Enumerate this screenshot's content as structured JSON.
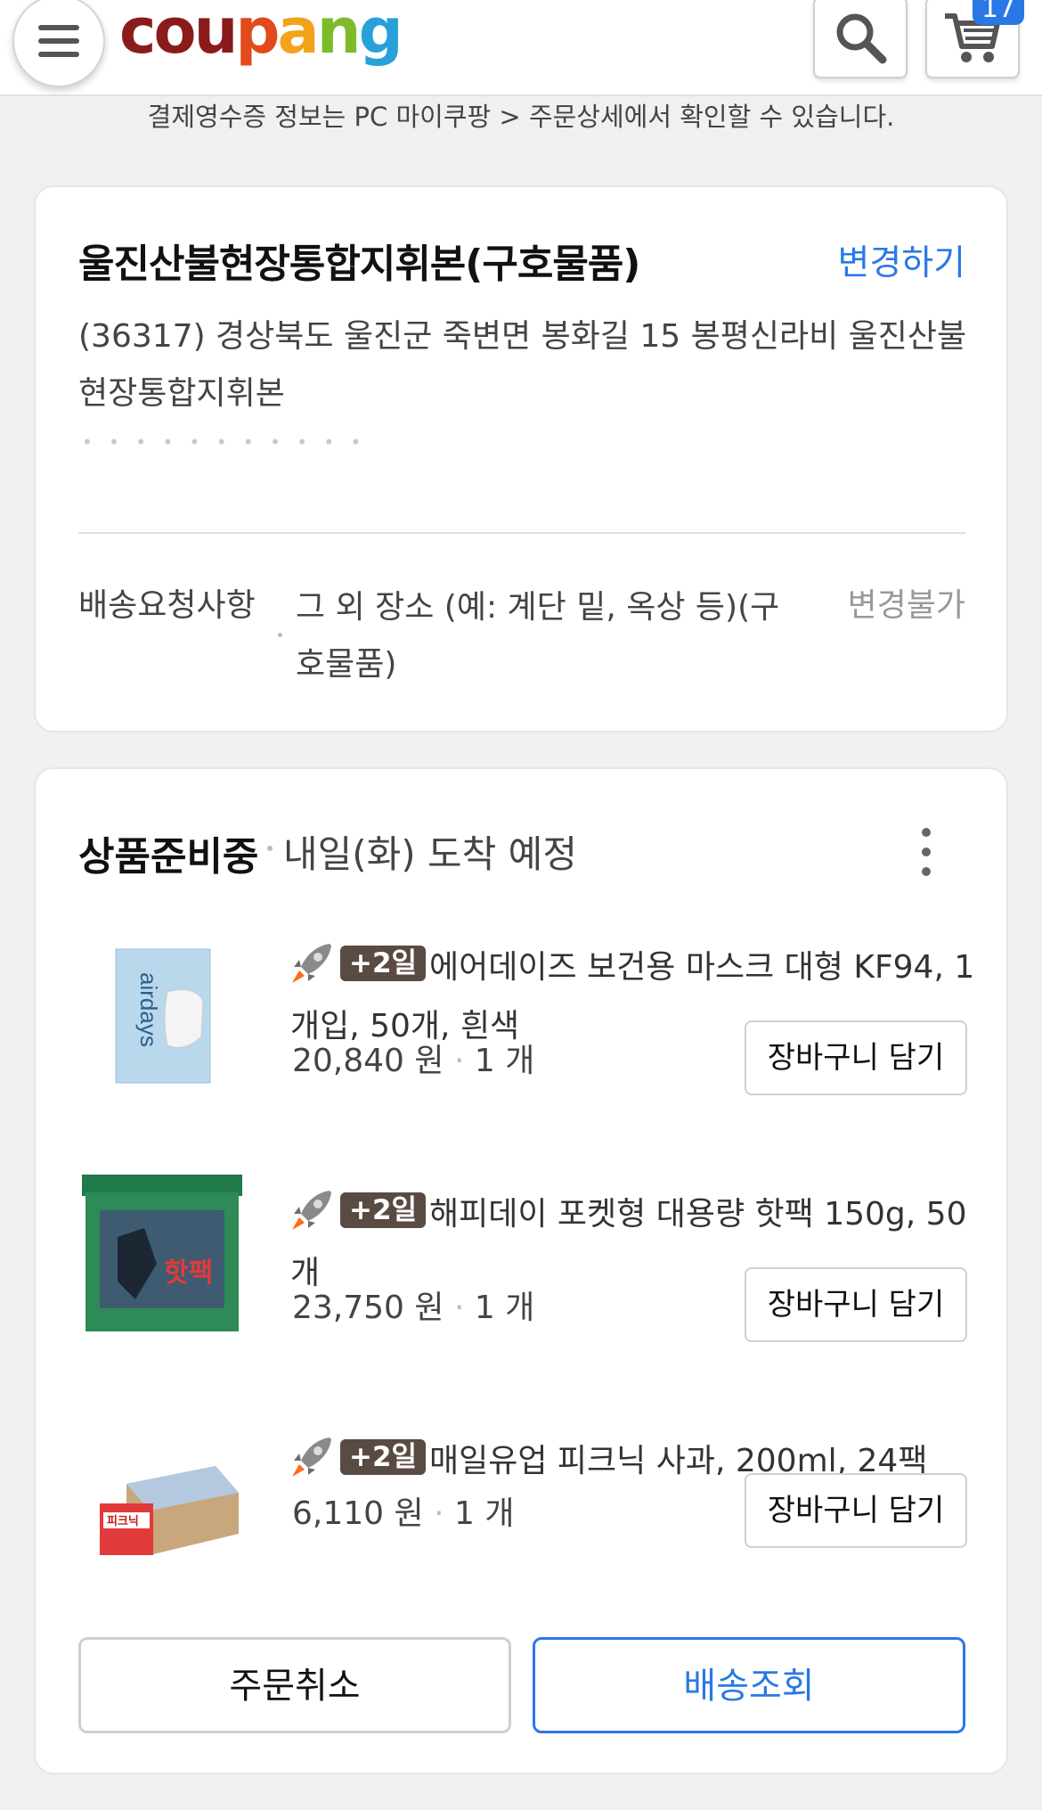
{
  "header": {
    "logo": [
      "cou",
      "p",
      "a",
      "n",
      "g"
    ],
    "cart_count": "17"
  },
  "notice": "결제영수증 정보는 PC 마이쿠팡 > 주문상세에서 확인할 수 있습니다.",
  "address_card": {
    "name": "울진산불현장통합지휘본(구호물품)",
    "change_label": "변경하기",
    "address": "(36317) 경상북도 울진군 죽변면 봉화길 15 봉평신라비 울진산불현장통합지휘본",
    "request_label": "배송요청사항",
    "request_value": "그 외 장소 (예: 계단 밑, 옥상 등)(구호물품)",
    "request_status": "변경불가"
  },
  "order_card": {
    "status": "상품준비중",
    "eta": "내일(화) 도착 예정",
    "items": [
      {
        "badge": "+2일",
        "name": "에어데이즈 보건용 마스크 대형 KF94, 1개입, 50개, 흰색",
        "price": "20,840 원",
        "qty": "1 개",
        "cart_label": "장바구니 담기",
        "thumb_text": "airdays"
      },
      {
        "badge": "+2일",
        "name": "해피데이 포켓형 대용량 핫팩 150g, 50개",
        "price": "23,750 원",
        "qty": "1 개",
        "cart_label": "장바구니 담기",
        "thumb_text": "핫팩"
      },
      {
        "badge": "+2일",
        "name": "매일유업 피크닉 사과, 200ml, 24팩",
        "price": "6,110 원",
        "qty": "1 개",
        "cart_label": "장바구니 담기",
        "thumb_text": "피크닉"
      }
    ],
    "cancel_label": "주문취소",
    "track_label": "배송조회"
  },
  "colors": {
    "accent": "#2a78e6",
    "badge_bg": "#5a4a44"
  }
}
